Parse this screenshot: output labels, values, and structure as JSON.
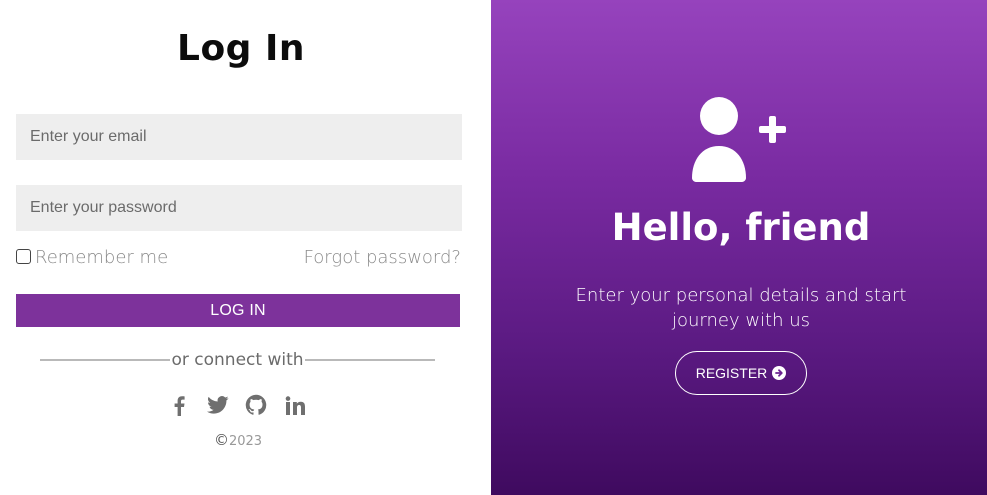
{
  "login": {
    "title": "Log In",
    "email_placeholder": "Enter your email",
    "password_placeholder": "Enter your password",
    "remember_label": "Remember me",
    "forgot_label": "Forgot password?",
    "login_button": "LOG IN",
    "divider_text": "or connect with",
    "socials": [
      "facebook-icon",
      "twitter-icon",
      "github-icon",
      "linkedin-icon"
    ],
    "copyright_symbol": "©",
    "copyright_year": "2023"
  },
  "register_panel": {
    "heading": "Hello, friend",
    "subtitle": "Enter your personal details and start journey with us",
    "register_button": "REGISTER",
    "icon": "user-plus-icon"
  },
  "colors": {
    "accent": "#7d329b",
    "gradient_top": "#9643bd",
    "gradient_bottom": "#3f0a5f",
    "input_bg": "#eeeeee"
  }
}
